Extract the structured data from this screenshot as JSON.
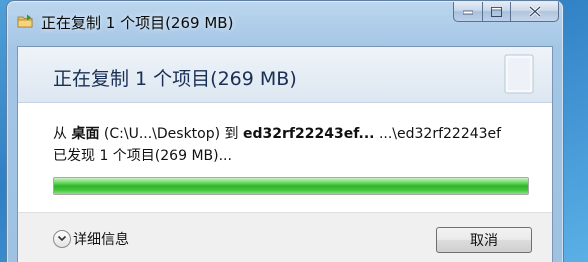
{
  "window": {
    "title": "正在复制 1 个项目(269 MB)"
  },
  "header": {
    "title": "正在复制 1 个项目(269 MB)"
  },
  "copy": {
    "from_word": "从",
    "source_name": "桌面",
    "source_path": "(C:\\U...\\Desktop)",
    "to_word": "到",
    "dest_name": "ed32rf22243ef...",
    "dest_path": "...\\ed32rf22243ef",
    "found_text": "已发现 1 个项目(269 MB)...",
    "progress_fraction": 1.0
  },
  "footer": {
    "details_label": "详细信息",
    "cancel_label": "取消"
  },
  "icons": {
    "title_icon": "copy-folder-icon",
    "header_icon": "document-icon",
    "details_toggle_icon": "chevron-down-icon",
    "minimize_icon": "minimize-icon",
    "maximize_icon": "maximize-icon",
    "close_icon": "close-icon"
  },
  "colors": {
    "progress_green": "#2fb52a",
    "header_text": "#1a2f55"
  }
}
